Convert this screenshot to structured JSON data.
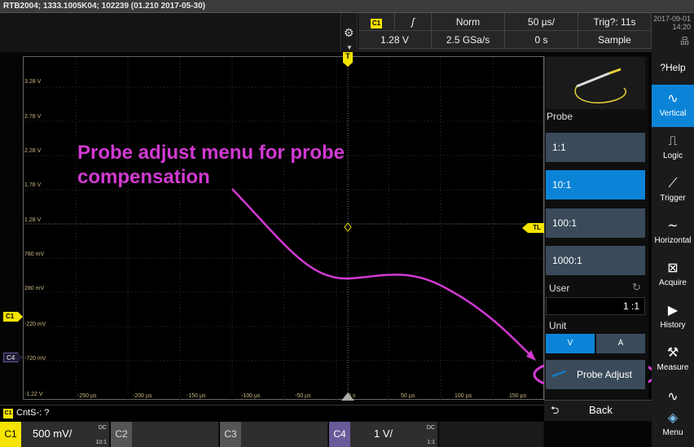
{
  "title": "RTB2004; 1333.1005K04; 102239 (01.210 2017-05-30)",
  "header": {
    "channel_badge": "C1",
    "slope_icon": "rising-edge",
    "mode": "Norm",
    "timebase": "50 µs/",
    "trig_time": "Trig?: 11s",
    "trig_level": "1.28 V",
    "sample_rate": "2.5 GSa/s",
    "offset": "0 s",
    "acq_mode": "Sample",
    "date": "2017-09-01",
    "time": "14:20"
  },
  "y_labels": [
    "3.28 V",
    "2.78 V",
    "2.28 V",
    "1.78 V",
    "1.28 V",
    "780 mV",
    "280 mV",
    "-220 mV",
    "-720 mV",
    "-1.22 V"
  ],
  "x_labels": [
    "-250 µs",
    "-200 µs",
    "-150 µs",
    "-100 µs",
    "-50 µs",
    "0 s",
    "50 µs",
    "100 µs",
    "150 µs"
  ],
  "markers": {
    "trigger": "T",
    "trigger_level": "TL",
    "c1": "C1",
    "c4": "C4"
  },
  "annotation": "Probe adjust menu for probe compensation",
  "panel": {
    "title": "Probe",
    "options": [
      "1:1",
      "10:1",
      "100:1",
      "1000:1"
    ],
    "selected_option": "10:1",
    "user_label": "User",
    "user_value": "1 :1",
    "unit_label": "Unit",
    "unit_v": "V",
    "unit_a": "A",
    "probe_adjust": "Probe Adjust",
    "back": "Back"
  },
  "sidebar": {
    "help": "Help",
    "items": [
      "Vertical",
      "Logic",
      "Trigger",
      "Horizontal",
      "Acquire",
      "History",
      "Measure",
      "Menu"
    ]
  },
  "status": {
    "badge": "C1",
    "text": "CntS-: ?"
  },
  "channels": {
    "c1_label": "C1",
    "c1_scale": "500 mV/",
    "c1_coupling": "DC",
    "c1_ratio": "10:1",
    "c2_label": "C2",
    "c3_label": "C3",
    "c4_label": "C4",
    "c4_scale": "1 V/",
    "c4_coupling": "DC",
    "c4_ratio": "1:1"
  },
  "colors": {
    "c1": "#f5e400",
    "c4": "#6a5a9a",
    "accent": "#0b84d8",
    "annotation": "#d23ad2"
  }
}
